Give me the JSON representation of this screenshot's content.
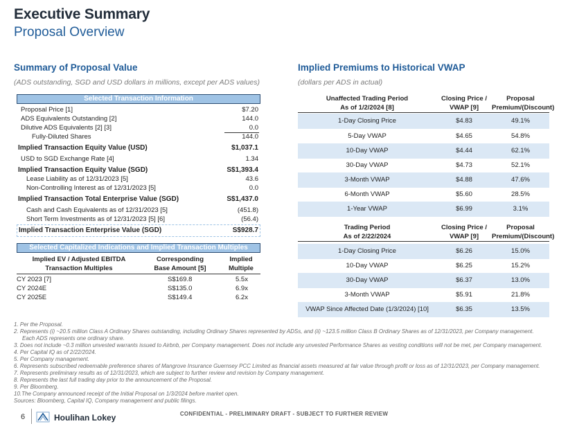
{
  "header": {
    "title": "Executive Summary",
    "subtitle": "Proposal Overview"
  },
  "left": {
    "section_title": "Summary of Proposal Value",
    "section_subtitle": "(ADS outstanding, SGD and USD dollars in millions, except per ADS values)",
    "box_title": "Selected Transaction Information",
    "rows": [
      {
        "label": "Proposal Price [1]",
        "value": "$7.20"
      },
      {
        "label": "ADS Equivalents Outstanding [2]",
        "value": "144.0"
      },
      {
        "label": "Dilutive ADS Equivalents [2] [3]",
        "value": "0.0"
      },
      {
        "label": "Fully-Diluted Shares",
        "value": "144.0"
      },
      {
        "label": "Implied Transaction Equity Value (USD)",
        "value": "$1,037.1"
      },
      {
        "label": "USD to SGD Exchange Rate [4]",
        "value": "1.34"
      },
      {
        "label": "Implied Transaction Equity Value (SGD)",
        "value": "S$1,393.4"
      },
      {
        "label": "Lease Liability as of 12/31/2023 [5]",
        "value": "43.6"
      },
      {
        "label": "Non-Controlling Interest as of 12/31/2023 [5]",
        "value": "0.0"
      },
      {
        "label": "Implied Transaction Total Enterprise Value (SGD)",
        "value": "S$1,437.0"
      },
      {
        "label": "Cash and Cash Equivalents as of 12/31/2023 [5]",
        "value": "(451.8)"
      },
      {
        "label": "Short Term Investments as of 12/31/2023 [5] [6]",
        "value": "(56.4)"
      },
      {
        "label": "Implied Transaction Enterprise Value (SGD)",
        "value": "S$928.7"
      }
    ],
    "multiples_title": "Selected Capitalized Indications and Implied Transaction Multiples",
    "multiples_headers": {
      "c1a": "Implied EV / Adjusted EBITDA",
      "c1b": "Transaction Multiples",
      "c2a": "Corresponding",
      "c2b": "Base Amount [5]",
      "c3a": "Implied",
      "c3b": "Multiple"
    },
    "multiples_rows": [
      {
        "label": "CY 2023 [7]",
        "base": "S$169.8",
        "mult": "5.5x"
      },
      {
        "label": "CY 2024E",
        "base": "S$135.0",
        "mult": "6.9x"
      },
      {
        "label": "CY 2025E",
        "base": "S$149.4",
        "mult": "6.2x"
      }
    ]
  },
  "right": {
    "section_title": "Implied Premiums to Historical VWAP",
    "section_subtitle": "(dollars per ADS in actual)",
    "table1": {
      "h1a": "Unaffected Trading Period",
      "h1b": "As of 1/2/2024 [8]",
      "h2a": "Closing Price /",
      "h2b": "VWAP [9]",
      "h3a": "Proposal",
      "h3b": "Premium/(Discount)",
      "rows": [
        {
          "period": "1-Day Closing Price",
          "price": "$4.83",
          "prem": "49.1%"
        },
        {
          "period": "5-Day VWAP",
          "price": "$4.65",
          "prem": "54.8%"
        },
        {
          "period": "10-Day VWAP",
          "price": "$4.44",
          "prem": "62.1%"
        },
        {
          "period": "30-Day VWAP",
          "price": "$4.73",
          "prem": "52.1%"
        },
        {
          "period": "3-Month VWAP",
          "price": "$4.88",
          "prem": "47.6%"
        },
        {
          "period": "6-Month VWAP",
          "price": "$5.60",
          "prem": "28.5%"
        },
        {
          "period": "1-Year VWAP",
          "price": "$6.99",
          "prem": "3.1%"
        }
      ]
    },
    "table2": {
      "h1a": "Trading Period",
      "h1b": "As of 2/22/2024",
      "h2a": "Closing Price /",
      "h2b": "VWAP [9]",
      "h3a": "Proposal",
      "h3b": "Premium/(Discount)",
      "rows": [
        {
          "period": "1-Day Closing Price",
          "price": "$6.26",
          "prem": "15.0%"
        },
        {
          "period": "10-Day VWAP",
          "price": "$6.25",
          "prem": "15.2%"
        },
        {
          "period": "30-Day VWAP",
          "price": "$6.37",
          "prem": "13.0%"
        },
        {
          "period": "3-Month VWAP",
          "price": "$5.91",
          "prem": "21.8%"
        },
        {
          "period": "VWAP Since Affected Date (1/3/2024) [10]",
          "price": "$6.35",
          "prem": "13.5%"
        }
      ]
    }
  },
  "footnotes": [
    "1.  Per the Proposal.",
    "2.  Represents (i) ~20.5 million Class A Ordinary Shares outstanding, including Ordinary Shares represented by ADSs, and (ii) ~123.5 million Class B Ordinary Shares as of 12/31/2023, per Company management. Each ADS represents one ordinary share.",
    "3.  Does not include ~0.3 million unvested warrants issued to Airbnb, per Company management. Does not include any unvested Performance Shares as vesting conditions will not be met, per Company management.",
    "4.  Per Capital IQ as of 2/22/2024.",
    "5.  Per Company management.",
    "6.  Represents subscribed redeemable preference shares of Mangrove Insurance Guernsey PCC Limited as financial assets measured at fair value through profit or loss as of 12/31/2023, per Company management.",
    "7.  Represents preliminary results as of 12/31/2023, which are subject to further review and revision by Company management.",
    "8.  Represents the last full trading day prior to the announcement of the Proposal.",
    "9.  Per Bloomberg.",
    "10.The Company announced receipt of the Initial Proposal on 1/3/2024 before market open.",
    "Sources: Bloomberg, Capital IQ, Company management and public filings."
  ],
  "footer": {
    "page_number": "6",
    "logo_text": "Houlihan Lokey",
    "confidential": "CONFIDENTIAL - PRELIMINARY DRAFT - SUBJECT TO FURTHER REVIEW"
  }
}
